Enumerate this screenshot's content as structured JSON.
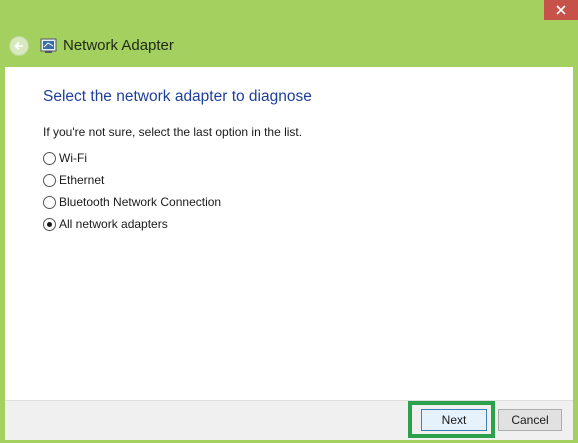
{
  "window": {
    "title": "Network Adapter",
    "back_icon": "back-arrow-icon",
    "app_icon": "network-adapter-icon",
    "close_icon": "close-icon"
  },
  "main": {
    "heading": "Select the network adapter to diagnose",
    "instruction": "If you're not sure, select the last option in the list.",
    "options": [
      {
        "label": "Wi-Fi",
        "selected": false
      },
      {
        "label": "Ethernet",
        "selected": false
      },
      {
        "label": "Bluetooth Network Connection",
        "selected": false
      },
      {
        "label": "All network adapters",
        "selected": true
      }
    ]
  },
  "footer": {
    "next_label": "Next",
    "cancel_label": "Cancel"
  },
  "colors": {
    "window_frame": "#a4d05f",
    "heading": "#1e3f9a",
    "highlight": "#2aa14a",
    "close_button": "#c7524a"
  }
}
